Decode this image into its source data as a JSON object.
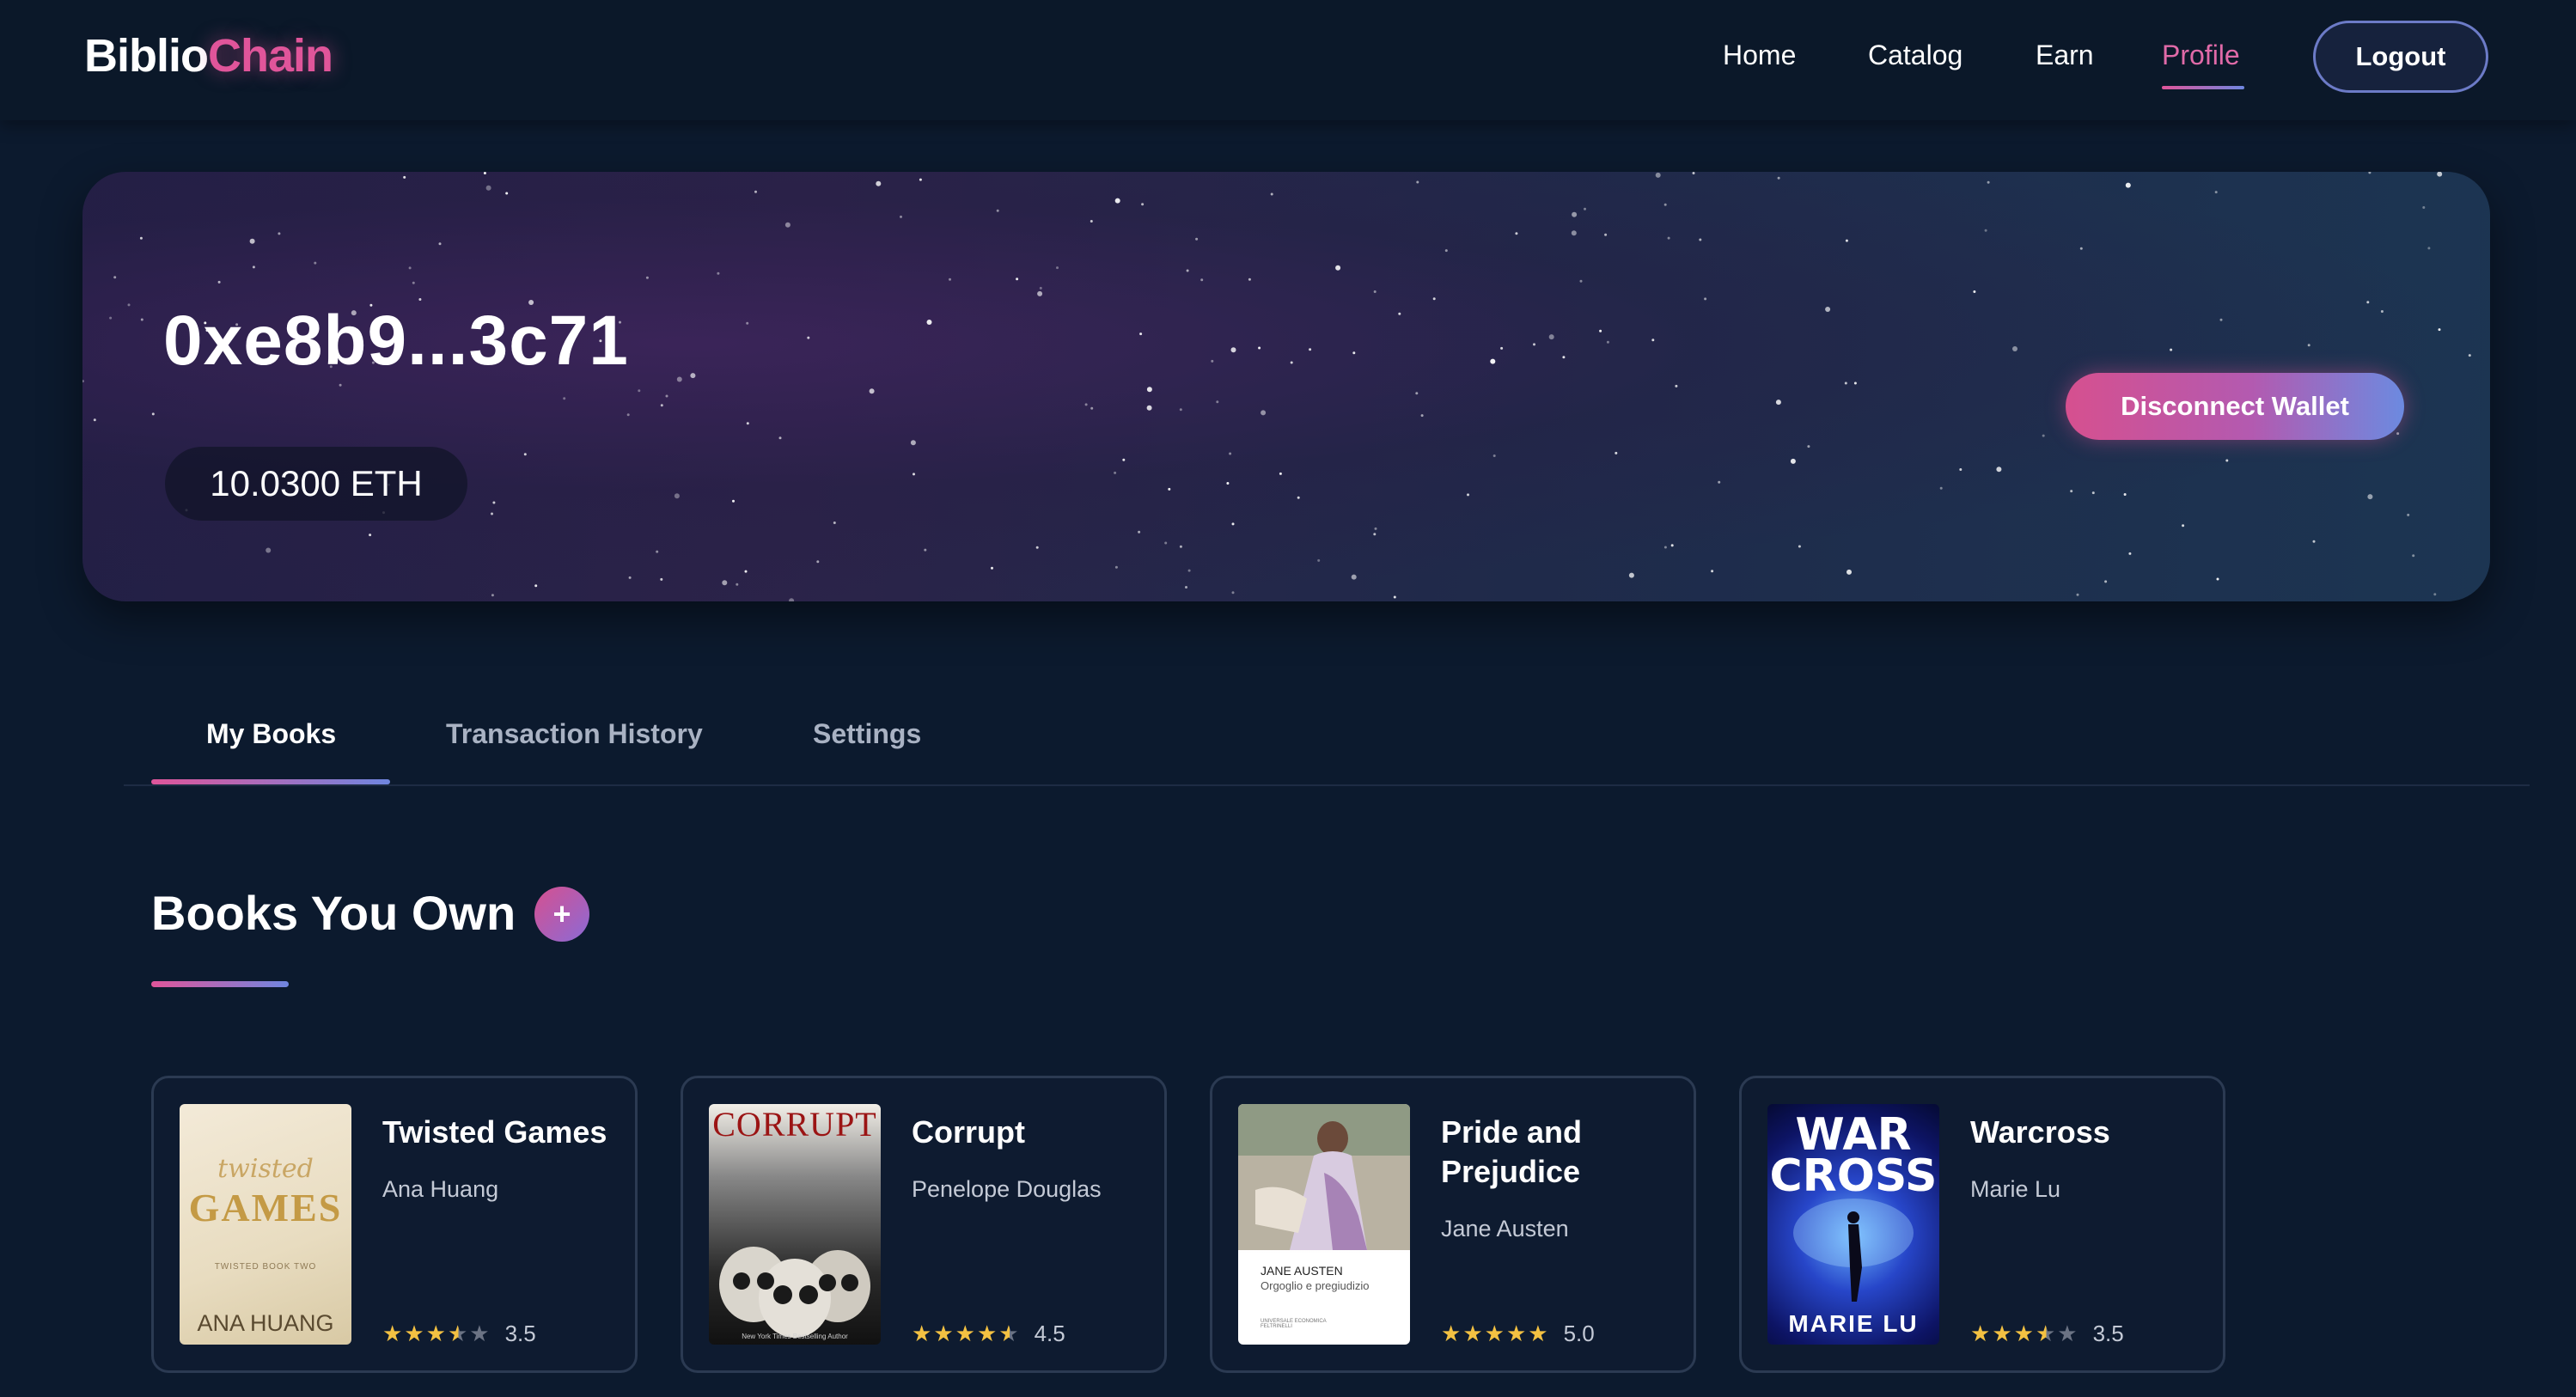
{
  "header": {
    "logo_part1": "Biblio",
    "logo_part2": "Chain",
    "nav": [
      "Home",
      "Catalog",
      "Earn",
      "Profile"
    ],
    "active_nav": "Profile",
    "logout_label": "Logout"
  },
  "hero": {
    "wallet_address": "0xe8b9...3c71",
    "balance": "10.0300 ETH",
    "disconnect_label": "Disconnect Wallet"
  },
  "tabs": {
    "items": [
      "My Books",
      "Transaction History",
      "Settings"
    ],
    "active": "My Books"
  },
  "section": {
    "title": "Books You Own",
    "add_icon": "plus-icon"
  },
  "books": [
    {
      "title": "Twisted Games",
      "author": "Ana Huang",
      "rating": 3.5,
      "rating_text": "3.5",
      "cover": {
        "top": "twisted",
        "main": "GAMES",
        "series": "TWISTED BOOK TWO",
        "author": "ANA HUANG"
      }
    },
    {
      "title": "Corrupt",
      "author": "Penelope Douglas",
      "rating": 4.5,
      "rating_text": "4.5",
      "cover": {
        "main": "CORRUPT",
        "footer": "New York Times Bestselling Author"
      }
    },
    {
      "title": "Pride and Prejudice",
      "author": "Jane Austen",
      "rating": 5.0,
      "rating_text": "5.0",
      "cover": {
        "author": "JANE AUSTEN",
        "subtitle": "Orgoglio e pregiudizio",
        "publisher": "UNIVERSALE ECONOMICA FELTRINELLI"
      }
    },
    {
      "title": "Warcross",
      "author": "Marie Lu",
      "rating": 3.5,
      "rating_text": "3.5",
      "cover": {
        "main_top": "WAR",
        "main_bottom": "CROSS",
        "author": "MARIE LU"
      }
    }
  ],
  "colors": {
    "background": "#0c1a2e",
    "accent_pink": "#e0559a",
    "accent_blue": "#6f86e0",
    "star": "#f3c142"
  }
}
